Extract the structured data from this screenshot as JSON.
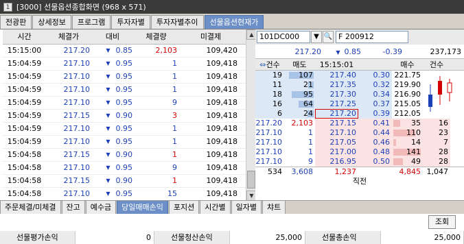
{
  "window": {
    "title": "[3000] 선물옵션종합화면 (968 x 571)",
    "icon_glyph": "1"
  },
  "top_tabs": [
    {
      "label": "전광판"
    },
    {
      "label": "상세정보"
    },
    {
      "label": "프로그램"
    },
    {
      "label": "투자자별"
    },
    {
      "label": "투자자별추이"
    },
    {
      "label": "선물옵션현재가"
    }
  ],
  "trades": {
    "headers": [
      "시간",
      "체결가",
      "대비",
      "체결량",
      "미결제"
    ],
    "rows": [
      {
        "time": "15:15:00",
        "price": "217.20",
        "diff": "0.85",
        "vol": "2,103",
        "oi": "109,420",
        "vol_color": "red"
      },
      {
        "time": "15:04:59",
        "price": "217.10",
        "diff": "0.95",
        "vol": "1",
        "oi": "109,418",
        "vol_color": "blue"
      },
      {
        "time": "15:04:59",
        "price": "217.10",
        "diff": "0.95",
        "vol": "1",
        "oi": "109,418",
        "vol_color": "blue"
      },
      {
        "time": "15:04:59",
        "price": "217.10",
        "diff": "0.95",
        "vol": "1",
        "oi": "109,418",
        "vol_color": "blue"
      },
      {
        "time": "15:04:59",
        "price": "217.10",
        "diff": "0.95",
        "vol": "9",
        "oi": "109,418",
        "vol_color": "blue"
      },
      {
        "time": "15:04:59",
        "price": "217.15",
        "diff": "0.90",
        "vol": "3",
        "oi": "109,418",
        "vol_color": "red"
      },
      {
        "time": "15:04:59",
        "price": "217.10",
        "diff": "0.95",
        "vol": "1",
        "oi": "109,418",
        "vol_color": "blue"
      },
      {
        "time": "15:04:59",
        "price": "217.10",
        "diff": "0.95",
        "vol": "1",
        "oi": "109,418",
        "vol_color": "blue"
      },
      {
        "time": "15:04:58",
        "price": "217.15",
        "diff": "0.90",
        "vol": "1",
        "oi": "109,418",
        "vol_color": "red"
      },
      {
        "time": "15:04:58",
        "price": "217.10",
        "diff": "0.95",
        "vol": "9",
        "oi": "109,418",
        "vol_color": "blue"
      },
      {
        "time": "15:04:58",
        "price": "217.15",
        "diff": "0.90",
        "vol": "1",
        "oi": "109,418",
        "vol_color": "red"
      },
      {
        "time": "15:04:58",
        "price": "217.10",
        "diff": "0.95",
        "vol": "15",
        "oi": "109,418",
        "vol_color": "blue"
      }
    ]
  },
  "quote": {
    "code": "101DC000",
    "name": "F 200912",
    "price": "217.20",
    "change": "0.85",
    "change_pct": "-0.39",
    "volume": "237,173"
  },
  "orderbook": {
    "headers": [
      "건수",
      "매도",
      "15:15:01",
      "",
      "매수",
      "건수"
    ],
    "sell": [
      {
        "cnt": "19",
        "qty": "107",
        "price": "217.40",
        "pct": "0.30",
        "bar": 0.9
      },
      {
        "cnt": "11",
        "qty": "21",
        "price": "217.35",
        "pct": "0.32",
        "bar": 0.2
      },
      {
        "cnt": "18",
        "qty": "95",
        "price": "217.30",
        "pct": "0.34",
        "bar": 0.8
      },
      {
        "cnt": "16",
        "qty": "64",
        "price": "217.25",
        "pct": "0.37",
        "bar": 0.55
      },
      {
        "cnt": "6",
        "qty": "24",
        "price": "217.20",
        "pct": "0.39",
        "bar": 0.22
      }
    ],
    "buy": [
      {
        "price_left": "217.20",
        "qty_left": "2,103",
        "price": "217.15",
        "pct": "0.41",
        "qty": "35",
        "cnt": "16",
        "bar": 0.25
      },
      {
        "price_left": "217.10",
        "qty_left": "1",
        "price": "217.10",
        "pct": "0.44",
        "qty": "110",
        "cnt": "23",
        "bar": 0.8
      },
      {
        "price_left": "217.10",
        "qty_left": "1",
        "price": "217.05",
        "pct": "0.46",
        "qty": "14",
        "cnt": "7",
        "bar": 0.1
      },
      {
        "price_left": "217.10",
        "qty_left": "1",
        "price": "217.00",
        "pct": "0.48",
        "qty": "141",
        "cnt": "28",
        "bar": 1.0
      },
      {
        "price_left": "217.10",
        "qty_left": "9",
        "price": "216.95",
        "pct": "0.50",
        "qty": "49",
        "cnt": "28",
        "bar": 0.35
      }
    ],
    "totals": {
      "sell_cnt": "534",
      "sell_qty": "3,608",
      "diff": "1,237",
      "buy_qty": "4,845",
      "buy_cnt": "1,047"
    },
    "footer": "직전",
    "side_prices": [
      "221.75",
      "219.90",
      "216.90",
      "215.05",
      "212.05"
    ]
  },
  "bottom_tabs": [
    {
      "label": "주문체결/미체결"
    },
    {
      "label": "잔고"
    },
    {
      "label": "예수금"
    },
    {
      "label": "당일매매손익"
    },
    {
      "label": "포지션"
    },
    {
      "label": "시간별"
    },
    {
      "label": "일자별"
    },
    {
      "label": "챠트"
    }
  ],
  "pnl": {
    "refresh_label": "조회",
    "eval_label": "선물평가손익",
    "eval_value": "0",
    "settle_label": "선물청산손익",
    "settle_value": "25,000",
    "total_label": "선물총손익",
    "total_value": "25,000"
  },
  "colors": {
    "accent": "#6b8fc6",
    "up": "#d40000",
    "down": "#1d3fb8"
  }
}
